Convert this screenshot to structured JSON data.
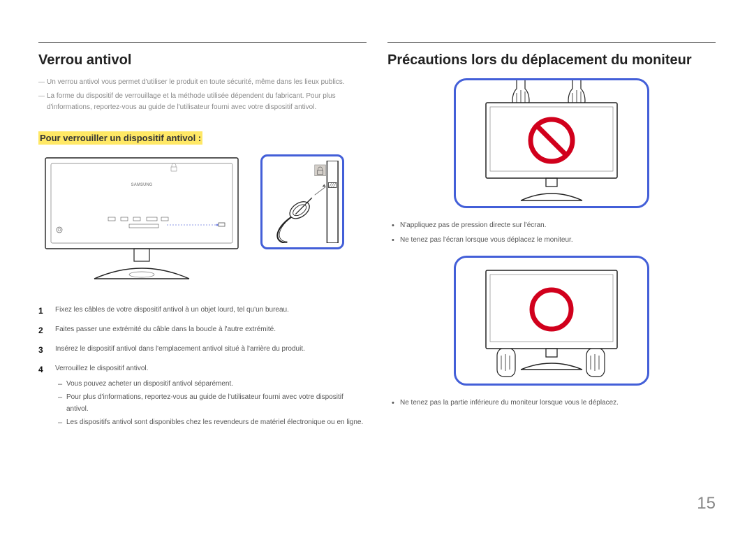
{
  "left": {
    "heading": "Verrou antivol",
    "notes": [
      "Un verrou antivol vous permet d'utiliser le produit en toute sécurité, même dans les lieux publics.",
      "La forme du dispositif de verrouillage et la méthode utilisée dépendent du fabricant. Pour plus d'informations, reportez-vous au guide de l'utilisateur fourni avec votre dispositif antivol."
    ],
    "subheading": "Pour verrouiller un dispositif antivol :",
    "steps": [
      {
        "num": "1",
        "text": "Fixez les câbles de votre dispositif antivol à un objet lourd, tel qu'un bureau."
      },
      {
        "num": "2",
        "text": "Faites passer une extrémité du câble dans la boucle à l'autre extrémité."
      },
      {
        "num": "3",
        "text": "Insérez le dispositif antivol dans l'emplacement antivol situé à l'arrière du produit."
      },
      {
        "num": "4",
        "text": "Verrouillez le dispositif antivol."
      }
    ],
    "substeps": [
      "Vous pouvez acheter un dispositif antivol séparément.",
      "Pour plus d'informations, reportez-vous au guide de l'utilisateur fourni avec votre dispositif antivol.",
      "Les dispositifs antivol sont disponibles chez les revendeurs de matériel électronique ou en ligne."
    ]
  },
  "right": {
    "heading": "Précautions lors du déplacement du moniteur",
    "bullets1": [
      "N'appliquez pas de pression directe sur l'écran.",
      "Ne tenez pas l'écran lorsque vous déplacez le moniteur."
    ],
    "bullets2": [
      "Ne tenez pas la partie inférieure du moniteur lorsque vous le déplacez."
    ]
  },
  "page_number": "15"
}
